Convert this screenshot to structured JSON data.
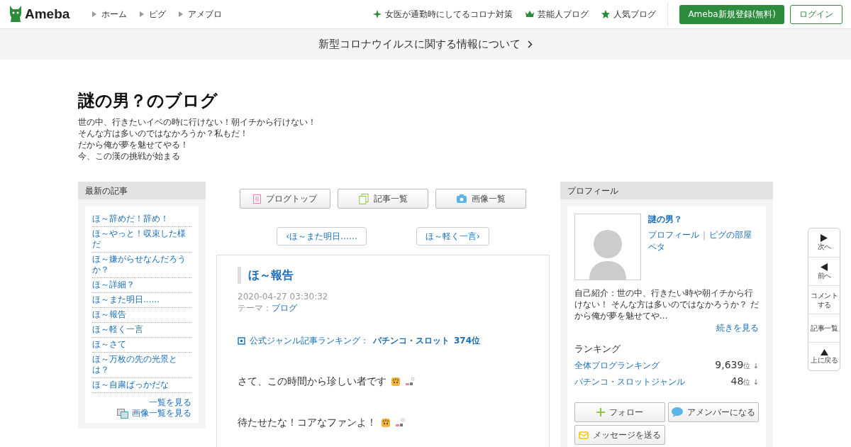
{
  "header": {
    "logo": "Ameba",
    "nav": [
      "ホーム",
      "ピグ",
      "アメブロ"
    ],
    "links": [
      {
        "kind": "sparkle",
        "label": "女医が通勤時にしてるコロナ対策"
      },
      {
        "kind": "crown",
        "label": "芸能人ブログ"
      },
      {
        "kind": "star",
        "label": "人気ブログ"
      }
    ],
    "register": "Ameba新規登録(無料)",
    "login": "ログイン"
  },
  "notice": "新型コロナウイルスに関する情報について",
  "blog": {
    "title": "謎の男？のブログ",
    "description": [
      "世の中、行きたいイベの時に行けない！朝イチから行けない！",
      "そんな方は多いのではなかろうか？私もだ！",
      "だから俺が夢を魅せてやる！",
      "今、この漢の挑戦が始まる"
    ]
  },
  "latest": {
    "heading": "最新の記事",
    "items": [
      "ほ～辞めだ！辞め！",
      "ほ～やっと！収束した様だ",
      "ほ～嫌がらせなんだろうか？",
      "ほ～詳細？",
      "ほ～また明日……",
      "ほ～報告",
      "ほ～軽く一言",
      "ほ～さて",
      "ほ～万枚の先の光景とは？",
      "ほ～自粛ばっかだな"
    ],
    "more": "一覧を見る",
    "images": "画像一覧を見る"
  },
  "tabs": [
    {
      "kind": "doc",
      "label": "ブログトップ"
    },
    {
      "kind": "pages",
      "label": "記事一覧"
    },
    {
      "kind": "camera",
      "label": "画像一覧"
    }
  ],
  "pager": {
    "prev_mark": "‹",
    "prev": "ほ～また明日……",
    "next": "ほ～軽く一言",
    "next_mark": "›"
  },
  "article": {
    "title": "ほ～報告",
    "date": "2020-04-27 03:30:32",
    "theme_label": "テーマ：",
    "theme": "ブログ",
    "ranking_label": "公式ジャンル記事ランキング：",
    "ranking_genre": "パチンコ・スロット",
    "ranking_rank": "374位",
    "paragraphs": [
      "さて、この時間から珍しい者です",
      "待たせたな！コアなファンよ！"
    ]
  },
  "profile": {
    "heading": "プロフィール",
    "name": "謎の男？",
    "links": [
      "プロフィール",
      "ピグの部屋"
    ],
    "separator": "|",
    "peta": "ペタ",
    "intro": "自己紹介：世の中、行きたい時や朝イチから行けない！ そんな方は多いのではなかろうか？ だから俺が夢を魅せてや...",
    "more": "続きを見る",
    "ranking_heading": "ランキング",
    "rankings": [
      {
        "label": "全体ブログランキング",
        "value": "9,639",
        "unit": "位 ↓"
      },
      {
        "label": "パチンコ・スロットジャンル",
        "value": "48",
        "unit": "位 ↓"
      }
    ],
    "buttons": [
      {
        "kind": "follow",
        "label": "フォロー"
      },
      {
        "kind": "amember",
        "label": "アメンバーになる"
      },
      {
        "kind": "message",
        "label": "メッセージを送る"
      }
    ]
  },
  "sidenav": [
    {
      "kind": "right",
      "label": "次へ"
    },
    {
      "kind": "left",
      "label": "前へ"
    },
    {
      "kind": "none",
      "label": "コメントする"
    },
    {
      "kind": "none",
      "label": "記事一覧"
    },
    {
      "kind": "up",
      "label": "上に戻る"
    }
  ]
}
